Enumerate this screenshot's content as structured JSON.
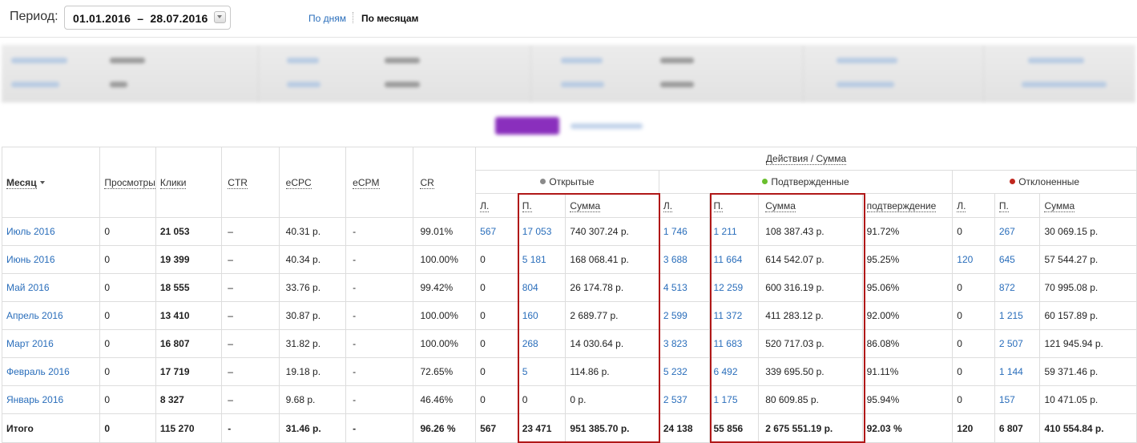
{
  "period": {
    "label": "Период:",
    "range": "01.01.2016  –  28.07.2016",
    "by_day": "По дням",
    "by_month": "По месяцам"
  },
  "table": {
    "group_header": "Действия / Сумма",
    "groups": {
      "open": "Открытые",
      "confirmed": "Подтвержденные",
      "rejected": "Отклоненные"
    },
    "status_colors": {
      "open": "#8a8a8a",
      "confirmed": "#6abf2e",
      "rejected": "#c0281f"
    },
    "highlight_color": "#b01818",
    "columns": {
      "month": "Месяц",
      "views": "Просмотры",
      "clicks": "Клики",
      "ctr": "CTR",
      "ecpc": "eCPC",
      "ecpm": "eCPM",
      "cr": "CR",
      "l": "Л.",
      "p": "П.",
      "sum": "Сумма",
      "confirmation": "подтверждение"
    },
    "rows": [
      [
        "Июль 2016",
        "0",
        "21 053",
        "–",
        "40.31 р.",
        "-",
        "99.01%",
        "567",
        "17 053",
        "740 307.24 р.",
        "1 746",
        "1 211",
        "108 387.43 р.",
        "91.72%",
        "0",
        "267",
        "30 069.15 р."
      ],
      [
        "Июнь 2016",
        "0",
        "19 399",
        "–",
        "40.34 р.",
        "-",
        "100.00%",
        "0",
        "5 181",
        "168 068.41 р.",
        "3 688",
        "11 664",
        "614 542.07 р.",
        "95.25%",
        "120",
        "645",
        "57 544.27 р."
      ],
      [
        "Май 2016",
        "0",
        "18 555",
        "–",
        "33.76 р.",
        "-",
        "99.42%",
        "0",
        "804",
        "26 174.78 р.",
        "4 513",
        "12 259",
        "600 316.19 р.",
        "95.06%",
        "0",
        "872",
        "70 995.08 р."
      ],
      [
        "Апрель 2016",
        "0",
        "13 410",
        "–",
        "30.87 р.",
        "-",
        "100.00%",
        "0",
        "160",
        "2 689.77 р.",
        "2 599",
        "11 372",
        "411 283.12 р.",
        "92.00%",
        "0",
        "1 215",
        "60 157.89 р."
      ],
      [
        "Март 2016",
        "0",
        "16 807",
        "–",
        "31.82 р.",
        "-",
        "100.00%",
        "0",
        "268",
        "14 030.64 р.",
        "3 823",
        "11 683",
        "520 717.03 р.",
        "86.08%",
        "0",
        "2 507",
        "121 945.94 р."
      ],
      [
        "Февраль 2016",
        "0",
        "17 719",
        "–",
        "19.18 р.",
        "-",
        "72.65%",
        "0",
        "5",
        "114.86 р.",
        "5 232",
        "6 492",
        "339 695.50 р.",
        "91.11%",
        "0",
        "1 144",
        "59 371.46 р."
      ],
      [
        "Январь 2016",
        "0",
        "8 327",
        "–",
        "9.68 р.",
        "-",
        "46.46%",
        "0",
        "0",
        "0 р.",
        "2 537",
        "1 175",
        "80 609.85 р.",
        "95.94%",
        "0",
        "157",
        "10 471.05 р."
      ]
    ],
    "total": [
      "Итого",
      "0",
      "115 270",
      "-",
      "31.46 р.",
      "-",
      "96.26 %",
      "567",
      "23 471",
      "951 385.70 р.",
      "24 138",
      "55 856",
      "2 675 551.19 р.",
      "92.03 %",
      "120",
      "6 807",
      "410 554.84 р."
    ]
  }
}
